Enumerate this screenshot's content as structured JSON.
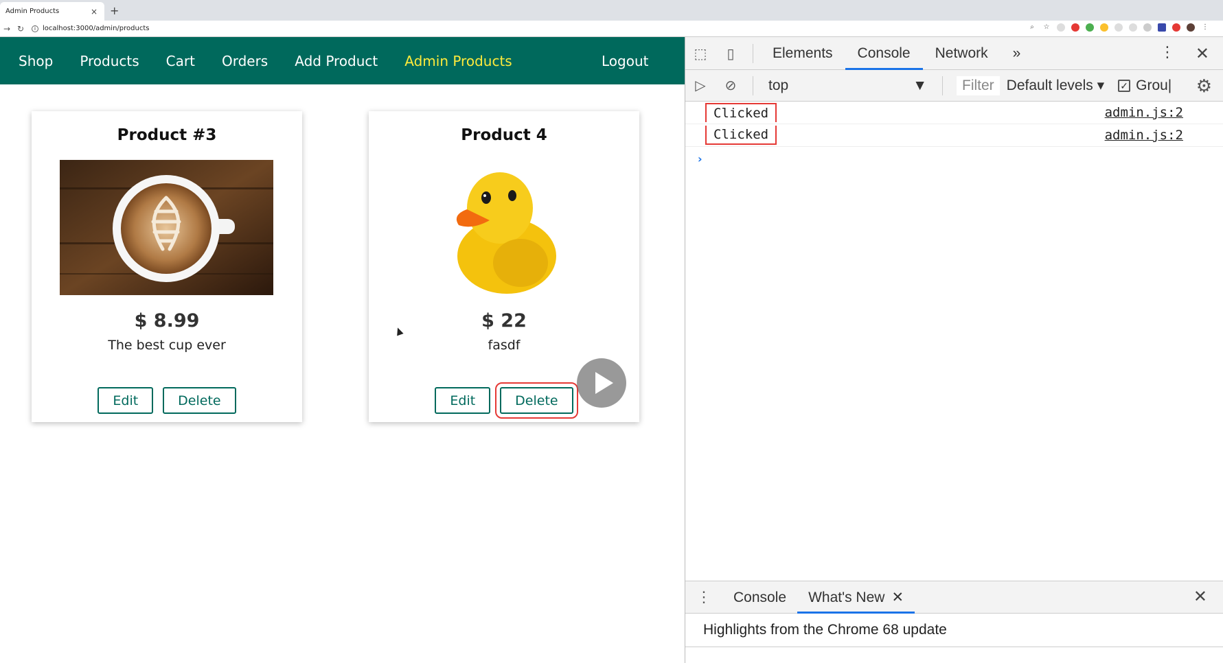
{
  "browser": {
    "tab_title": "Admin Products",
    "tab_close": "×",
    "new_tab": "+",
    "url": "localhost:3000/admin/products"
  },
  "site_nav": {
    "items": [
      {
        "label": "Shop",
        "active": false
      },
      {
        "label": "Products",
        "active": false
      },
      {
        "label": "Cart",
        "active": false
      },
      {
        "label": "Orders",
        "active": false
      },
      {
        "label": "Add Product",
        "active": false
      },
      {
        "label": "Admin Products",
        "active": true
      }
    ],
    "logout": "Logout",
    "bg_color": "#00695c",
    "active_color": "#ffeb3b"
  },
  "products": [
    {
      "title": "Product #3",
      "image": "coffee-cup-image",
      "price": "$ 8.99",
      "description": "The best cup ever",
      "edit_label": "Edit",
      "delete_label": "Delete"
    },
    {
      "title": "Product 4",
      "image": "rubber-duck-image",
      "price": "$ 22",
      "description": "fasdf",
      "edit_label": "Edit",
      "delete_label": "Delete"
    }
  ],
  "devtools": {
    "tabs": [
      "Elements",
      "Console",
      "Network"
    ],
    "active_tab": "Console",
    "more": "»",
    "context": "top",
    "filter_placeholder": "Filter",
    "levels": "Default levels",
    "group_label": "Grou|",
    "logs": [
      {
        "message": "Clicked",
        "source": "admin.js:2"
      },
      {
        "message": "Clicked",
        "source": "admin.js:2"
      }
    ],
    "prompt": "›",
    "drawer": {
      "tabs": [
        "Console",
        "What's New"
      ],
      "active_tab": "What's New",
      "highlight_text": "Highlights from the Chrome 68 update"
    },
    "accent_color": "#1a73e8"
  },
  "annotation_color": "#e53935"
}
